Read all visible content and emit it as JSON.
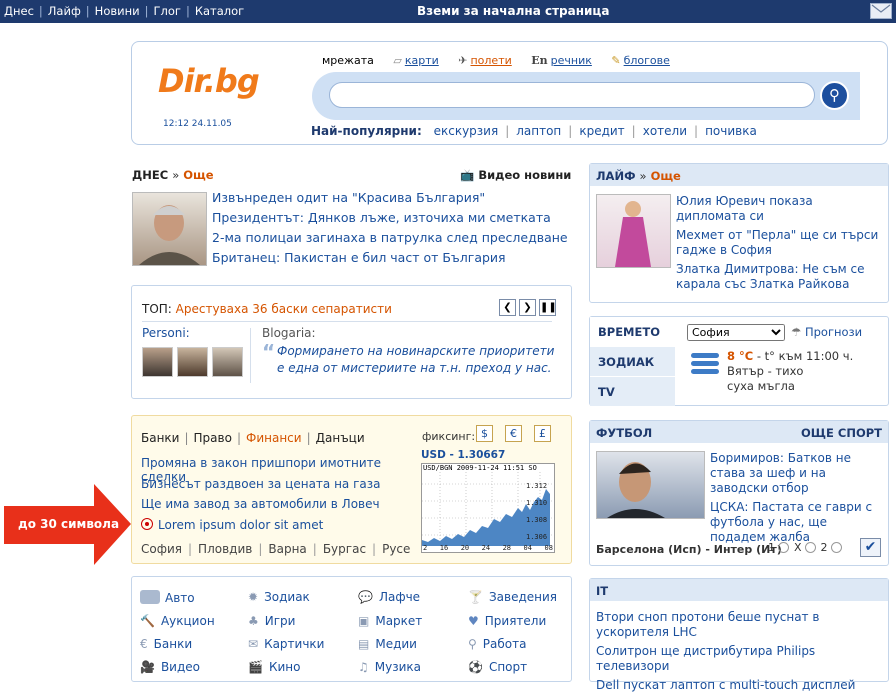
{
  "topbar": {
    "nav": [
      "Днес",
      "Лайф",
      "Новини",
      "Глог",
      "Каталог"
    ],
    "home_label": "Вземи за начална страница"
  },
  "logo": {
    "text_a": "Dir",
    "text_b": ".bg"
  },
  "clock": "12:12 24.11.05",
  "search": {
    "tabs": [
      "мрежата",
      "карти",
      "полети",
      "речник",
      "блогове"
    ],
    "value": "",
    "popular_label": "Най-популярни:",
    "popular": [
      "екскурзия",
      "лаптоп",
      "кредит",
      "хотели",
      "почивка"
    ]
  },
  "today": {
    "label": "ДНЕС",
    "more": "Още",
    "video": "Видео новини",
    "items": [
      "Извънреден одит на \"Красива България\"",
      "Президентът: Дянков лъже, източиха ми сметката",
      "2-ма полицаи загинаха в патрулка след преследване",
      "Британец: Пакистан е бил част от България"
    ]
  },
  "top": {
    "label": "ТОП:",
    "headline": "Арестуваха 36 баски сепаратисти",
    "personi": "Personi:",
    "blogaria": "Blogaria:",
    "quote": "Формирането на новинарските приоритети е една от мистериите на т.н. преход у нас."
  },
  "finance": {
    "tabs": [
      "Банки",
      "Право",
      "Финанси",
      "Данъци"
    ],
    "fixing": "фиксинг:",
    "currencies": [
      "$",
      "€",
      "£"
    ],
    "rate": "USD - 1.30667",
    "chart_head": "USD/BGN 2009-11-24 11:51 SO",
    "chart_y": [
      "1.312",
      "1.310",
      "1.308",
      "1.306"
    ],
    "chart_x": [
      "2",
      "16",
      "20",
      "24",
      "28",
      "04",
      "08"
    ],
    "items": [
      "Промяна в закон пришпори имотните сделки",
      "Бизнесът раздвоен за цената на газа",
      "Ще има завод за автомобили в Ловеч",
      "Lorem ipsum dolor sit amet"
    ],
    "cities": [
      "София",
      "Пловдив",
      "Варна",
      "Бургас",
      "Русе"
    ],
    "callout": "до 30 символа"
  },
  "categories": [
    [
      "Авто",
      "Зодиак",
      "Лафче",
      "Заведения"
    ],
    [
      "Аукцион",
      "Игри",
      "Маркет",
      "Приятели"
    ],
    [
      "Банки",
      "Картички",
      "Медии",
      "Работа"
    ],
    [
      "Видео",
      "Кино",
      "Музика",
      "Спорт"
    ]
  ],
  "life": {
    "label": "ЛАЙФ",
    "more": "Още",
    "items": [
      "Юлия Юревич показа дипломата си",
      "Мехмет от \"Перла\" ще си търси гадже в София",
      "Златка Димитрова: Не съм се карала със Златка Райкова"
    ]
  },
  "weather": {
    "tabs": [
      "ВРЕМЕТО",
      "ЗОДИАК",
      "TV"
    ],
    "city": "София",
    "forecast": "Прогнози",
    "temp": "8 °C",
    "desc1": " - t° към 11:00 ч.",
    "desc2": "Вятър - тихо",
    "desc3": "суха мъгла"
  },
  "football": {
    "label": "ФУТБОЛ",
    "more": "ОЩЕ СПОРТ",
    "items": [
      "Боримиров: Батков не става за шеф и на заводски отбор",
      "ЦСКА: Пастата се гаври с футбола у нас, ще подадем жалба"
    ],
    "match": "Барселона (Исп) - Интер (Ит)",
    "opts": [
      "1",
      "X",
      "2"
    ]
  },
  "it": {
    "label": "IT",
    "items": [
      "Втори сноп протони беше пуснат в ускорителя LHC",
      "Солитрон ще дистрибутира Philips телевизори",
      "Dell пускат лаптоп с multi-touch дисплей"
    ]
  }
}
